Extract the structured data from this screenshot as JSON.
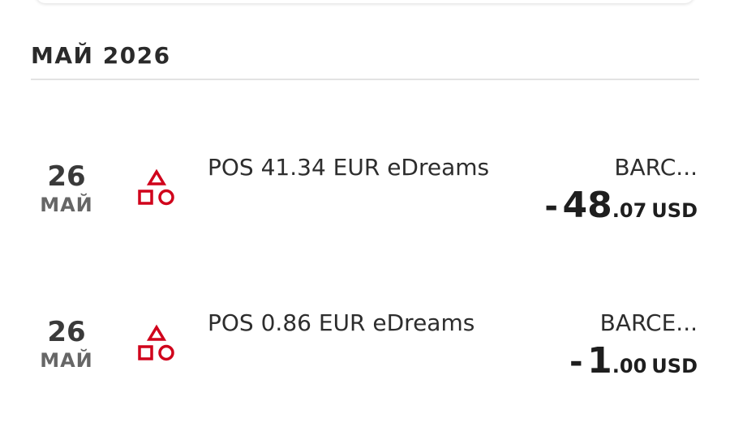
{
  "section": {
    "month_header": "МАЙ 2026"
  },
  "transactions": [
    {
      "day": "26",
      "month": "МАЙ",
      "icon": "shapes-category-icon",
      "description": "POS 41.34 EUR eDreams",
      "location": "BARC...",
      "amount_sign": "-",
      "amount_int": "48",
      "amount_dec": ".07",
      "currency": "USD"
    },
    {
      "day": "26",
      "month": "МАЙ",
      "icon": "shapes-category-icon",
      "description": "POS 0.86 EUR eDreams",
      "location": "BARCE...",
      "amount_sign": "-",
      "amount_int": "1",
      "amount_dec": ".00",
      "currency": "USD"
    }
  ],
  "colors": {
    "accent_red": "#d0021b",
    "text_dark": "#2d2d2d",
    "text_muted": "#666666",
    "divider": "#e3e3e3"
  }
}
